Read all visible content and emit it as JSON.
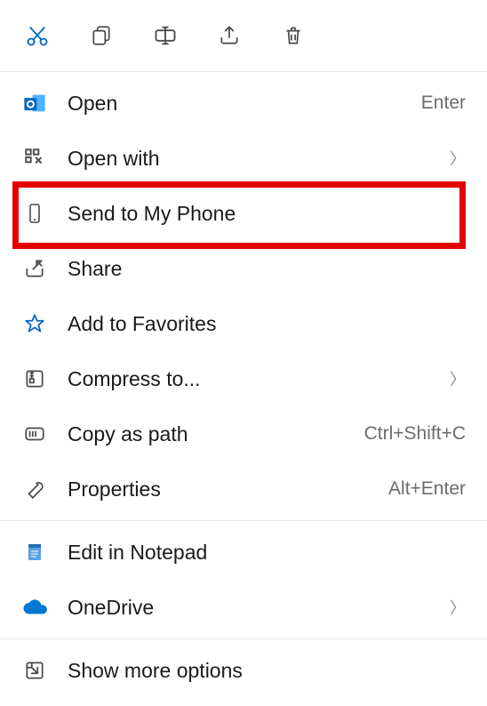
{
  "toolbar": {
    "cut": "cut-icon",
    "copy": "copy-icon",
    "rename": "rename-icon",
    "share": "share-icon",
    "delete": "delete-icon"
  },
  "items": {
    "open": {
      "label": "Open",
      "shortcut": "Enter"
    },
    "openWith": {
      "label": "Open with"
    },
    "sendToPhone": {
      "label": "Send to My Phone"
    },
    "share": {
      "label": "Share"
    },
    "addToFavorites": {
      "label": "Add to Favorites"
    },
    "compressTo": {
      "label": "Compress to..."
    },
    "copyAsPath": {
      "label": "Copy as path",
      "shortcut": "Ctrl+Shift+C"
    },
    "properties": {
      "label": "Properties",
      "shortcut": "Alt+Enter"
    },
    "editInNotepad": {
      "label": "Edit in Notepad"
    },
    "oneDrive": {
      "label": "OneDrive"
    },
    "showMore": {
      "label": "Show more options"
    }
  }
}
